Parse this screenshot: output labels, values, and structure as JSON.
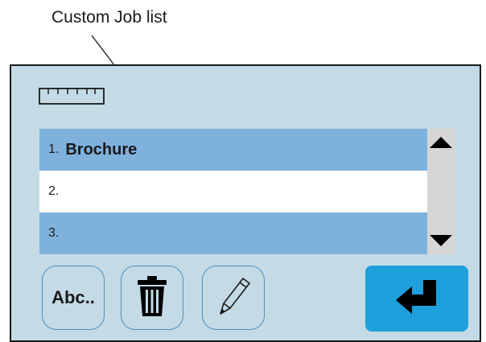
{
  "callout": {
    "label": "Custom Job list"
  },
  "panel": {
    "ruler_icon": "ruler-icon",
    "job_list": [
      {
        "number": "1.",
        "name": "Brochure"
      },
      {
        "number": "2.",
        "name": ""
      },
      {
        "number": "3.",
        "name": ""
      }
    ],
    "buttons": {
      "rename_label": "Abc..",
      "delete_icon": "trash-icon",
      "edit_icon": "pencil-icon",
      "enter_icon": "enter-arrow-icon"
    }
  },
  "colors": {
    "panel_bg": "#c4dbe6",
    "row_highlight": "#7fb1dd",
    "enter_button": "#1ea0dc",
    "button_border": "#4a90c0"
  }
}
